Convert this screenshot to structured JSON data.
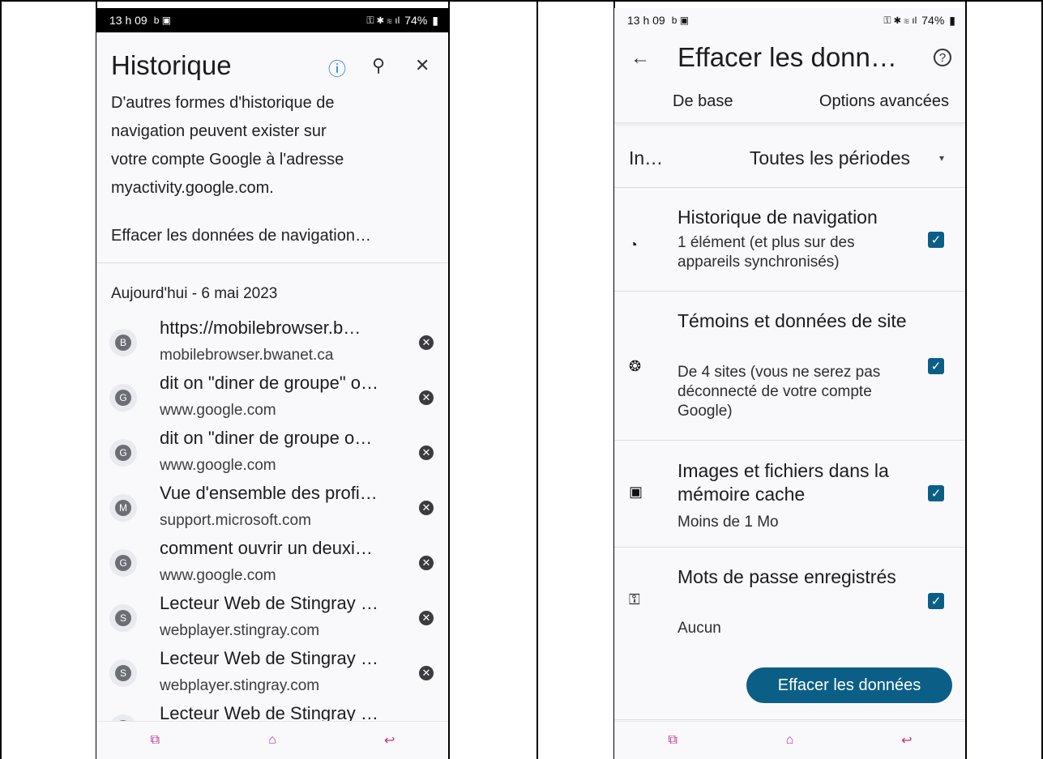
{
  "left": {
    "status": {
      "time": "13 h 09",
      "small_icons": "b ▣",
      "right_icons": "⚿ ✱ ≋ ıl",
      "battery": "74%"
    },
    "title": "Historique",
    "icons": {
      "info": "ⓘ",
      "search": "⚲",
      "close": "✕"
    },
    "paragraph": [
      "D'autres formes d'historique de",
      "navigation peuvent exister sur",
      "votre compte Google à l'adresse",
      "myactivity.google.com."
    ],
    "clear_link": "Effacer les données de navigation…",
    "date_header": "Aujourd'hui - 6 mai 2023",
    "items": [
      {
        "letter": "B",
        "title": "https://mobilebrowser.b…",
        "url": "mobilebrowser.bwanet.ca"
      },
      {
        "letter": "G",
        "title": "dit on \"diner de groupe\" o…",
        "url": "www.google.com"
      },
      {
        "letter": "G",
        "title": "dit on \"diner de groupe o…",
        "url": "www.google.com"
      },
      {
        "letter": "M",
        "title": "Vue d'ensemble des profi…",
        "url": "support.microsoft.com"
      },
      {
        "letter": "G",
        "title": "comment ouvrir un deuxi…",
        "url": "www.google.com"
      },
      {
        "letter": "S",
        "title": "Lecteur Web de Stingray …",
        "url": "webplayer.stingray.com"
      },
      {
        "letter": "S",
        "title": "Lecteur Web de Stingray …",
        "url": "webplayer.stingray.com"
      },
      {
        "letter": "S",
        "title": "Lecteur Web de Stingray …",
        "url": ""
      }
    ],
    "nav": {
      "recent": "⧉",
      "home": "⌂",
      "back": "↩"
    }
  },
  "right": {
    "status": {
      "time": "13 h 09",
      "small_icons": "b ▣",
      "right_icons": "⚿ ✱ ≋ ıl",
      "battery": "74%"
    },
    "back_icon": "←",
    "title": "Effacer les donn…",
    "help_icon": "?",
    "tabs": {
      "basic": "De base",
      "advanced": "Options avancées"
    },
    "range": {
      "label": "In…",
      "value": "Toutes les périodes",
      "caret": "▾"
    },
    "options": [
      {
        "icon": "clock-icon",
        "glyph": "◔",
        "title": "Historique de navigation",
        "subtitle": "1 élément (et plus sur des appareils synchronisés)",
        "checked": true
      },
      {
        "icon": "cookie-icon",
        "glyph": "❂",
        "title": "Témoins et données de site",
        "subtitle": "De 4 sites (vous ne serez pas déconnecté de votre compte Google)",
        "checked": true
      },
      {
        "icon": "image-icon",
        "glyph": "▣",
        "title": "Images et fichiers dans la mémoire cache",
        "subtitle": "Moins de 1 Mo",
        "checked": true
      },
      {
        "icon": "key-icon",
        "glyph": "⚿",
        "title": "Mots de passe enregistrés",
        "subtitle": "Aucun",
        "checked": true
      }
    ],
    "check_glyph": "✓",
    "clear_button": "Effacer les données",
    "nav": {
      "recent": "⧉",
      "home": "⌂",
      "back": "↩"
    }
  }
}
